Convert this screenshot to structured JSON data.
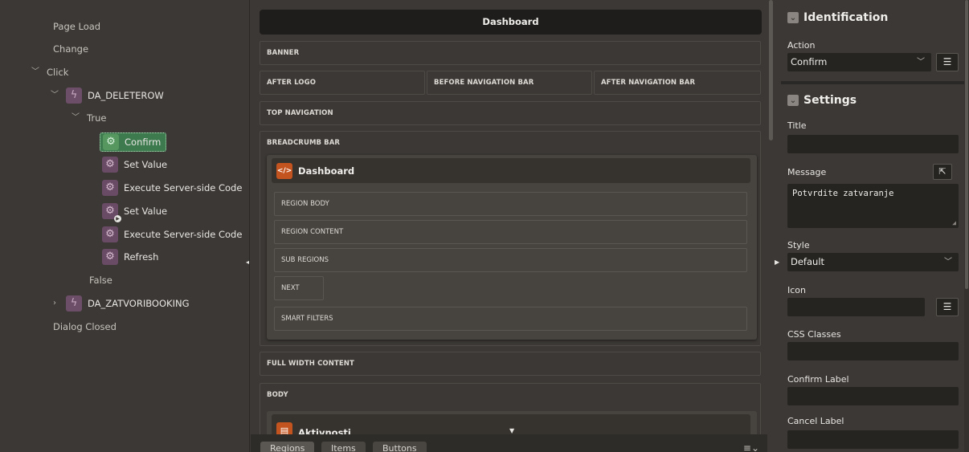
{
  "tree": {
    "page_load": "Page Load",
    "change": "Change",
    "click": "Click",
    "da_deleterow": "DA_DELETEROW",
    "true_branch": "True",
    "actions": [
      {
        "label": "Confirm"
      },
      {
        "label": "Set Value"
      },
      {
        "label": "Execute Server-side Code"
      },
      {
        "label": "Set Value"
      },
      {
        "label": "Execute Server-side Code"
      },
      {
        "label": "Refresh"
      }
    ],
    "false_branch": "False",
    "da_zatvoribooking": "DA_ZATVORIBOOKING",
    "dialog_closed": "Dialog Closed"
  },
  "layout": {
    "page_title": "Dashboard",
    "banner": "BANNER",
    "after_logo": "AFTER LOGO",
    "before_nav_bar": "BEFORE NAVIGATION BAR",
    "after_nav_bar": "AFTER NAVIGATION BAR",
    "top_navigation": "TOP NAVIGATION",
    "breadcrumb_bar": "BREADCRUMB BAR",
    "region_title": "Dashboard",
    "region_body": "REGION BODY",
    "region_content": "REGION CONTENT",
    "sub_regions": "SUB REGIONS",
    "next": "NEXT",
    "smart_filters": "SMART FILTERS",
    "full_width_content": "FULL WIDTH CONTENT",
    "body": "BODY",
    "region2_title": "Aktivnosti",
    "tabs": [
      "Regions",
      "Items",
      "Buttons"
    ]
  },
  "props": {
    "identification": "Identification",
    "action_label": "Action",
    "action_value": "Confirm",
    "settings": "Settings",
    "title_label": "Title",
    "message_label": "Message",
    "message_value": "Potvrdite zatvaranje",
    "style_label": "Style",
    "style_value": "Default",
    "icon_label": "Icon",
    "css_classes_label": "CSS Classes",
    "confirm_label_label": "Confirm Label",
    "cancel_label_label": "Cancel Label"
  },
  "colors": {
    "background": "#3b3835",
    "selected": "#3d7a4e",
    "action_icon": "#6a4b66",
    "region_icon": "#c4541f"
  },
  "icons": {
    "dynamic_action": "lightning-icon",
    "action": "gear-icon",
    "static_content_region": "code-icon",
    "report_region": "table-icon"
  }
}
